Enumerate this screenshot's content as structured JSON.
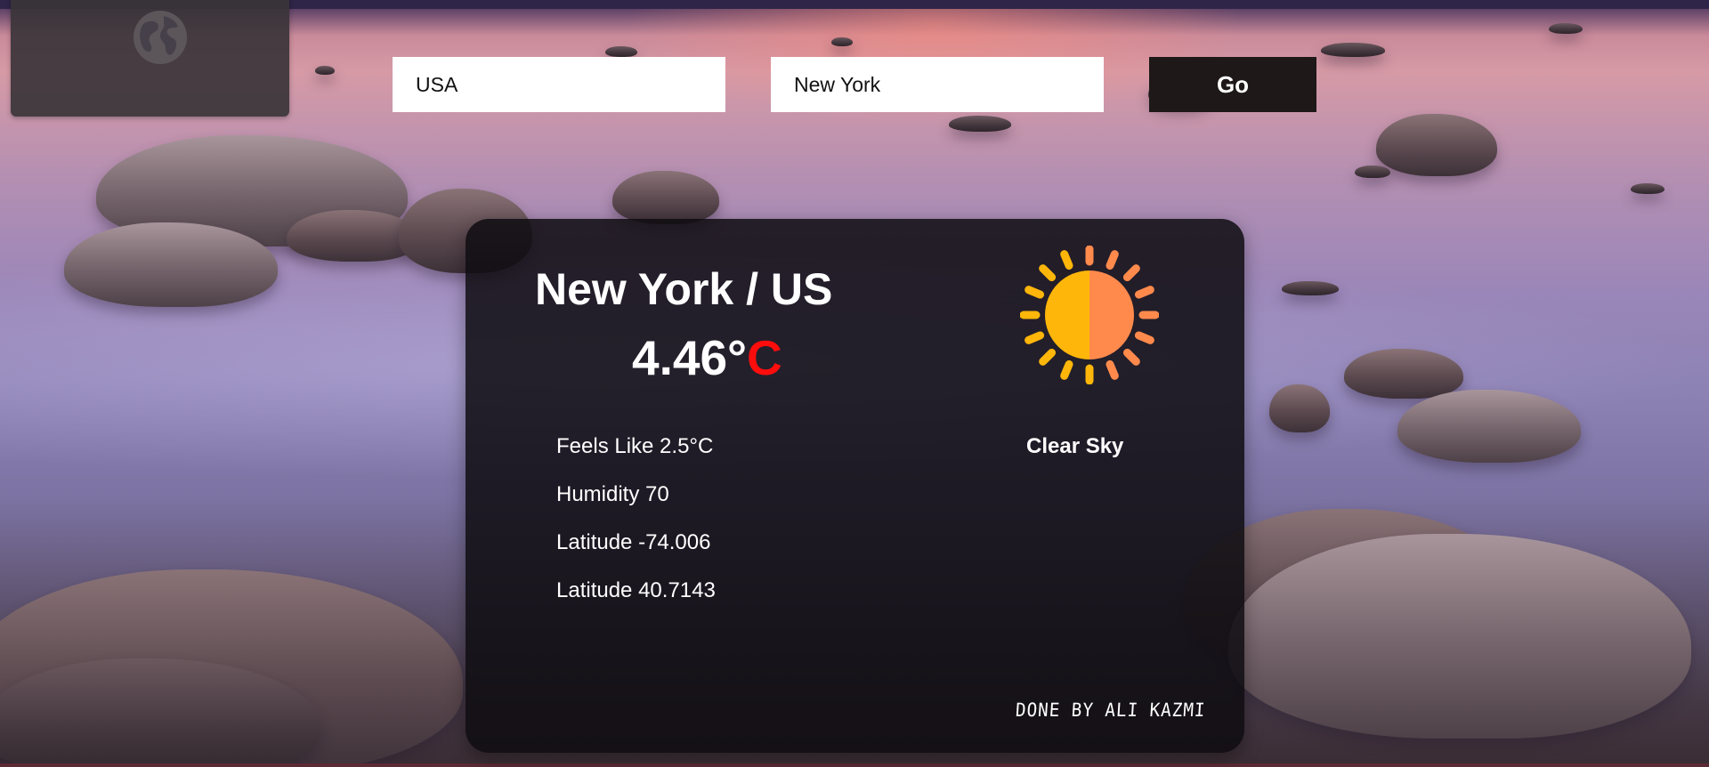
{
  "search": {
    "country_value": "USA",
    "city_value": "New York",
    "go_label": "Go"
  },
  "weather": {
    "location": "New York / US",
    "temperature": "4.46°",
    "unit": "C",
    "feels_like": "Feels Like 2.5°C",
    "humidity": "Humidity 70",
    "longitude": "Latitude -74.006",
    "latitude": "Latitude 40.7143",
    "condition": "Clear Sky",
    "condition_icon": "sun-icon"
  },
  "footer": {
    "credit": "DONE BY ALI KAZMI"
  },
  "colors": {
    "unit_accent": "#ff0d0d",
    "sun_left": "#ffb60a",
    "sun_right": "#ff8a4c",
    "card_bg": "#0e0c10",
    "go_button_bg": "#1e1819"
  },
  "logo": {
    "icon": "globe-icon"
  }
}
